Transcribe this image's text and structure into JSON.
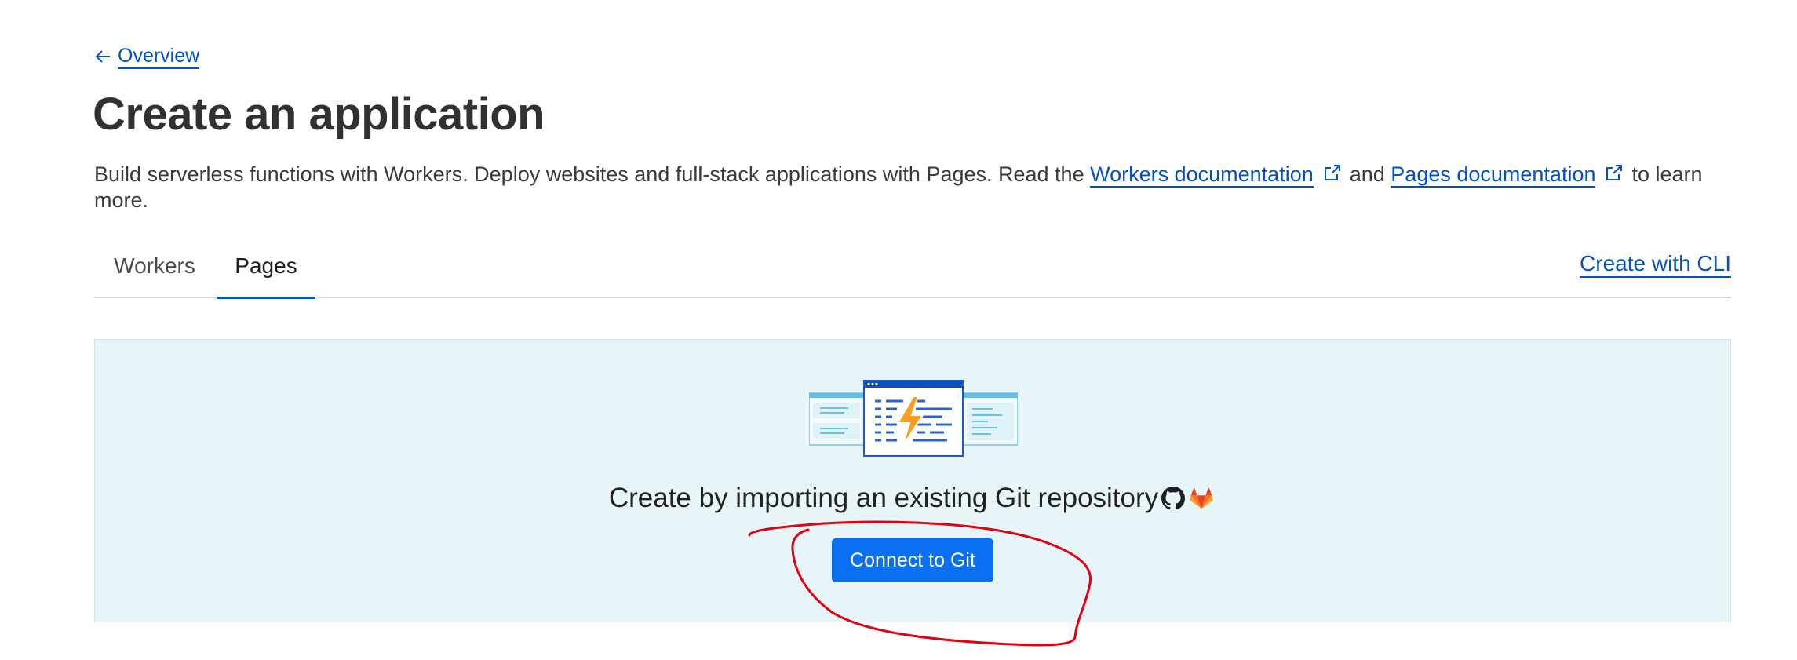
{
  "nav": {
    "back_label": "Overview"
  },
  "header": {
    "title": "Create an application",
    "description_prefix": "Build serverless functions with Workers. Deploy websites and full-stack applications with Pages. Read the ",
    "workers_docs_link": "Workers documentation",
    "and_text": "and ",
    "pages_docs_link": "Pages documentation",
    "description_suffix": "to learn more."
  },
  "tabs": [
    {
      "label": "Workers",
      "active": false
    },
    {
      "label": "Pages",
      "active": true
    }
  ],
  "cli_link": "Create with CLI",
  "panel": {
    "heading": "Create by importing an existing Git repository",
    "button_label": "Connect to Git",
    "provider_icons": [
      "github-icon",
      "gitlab-icon"
    ]
  },
  "colors": {
    "link": "#0051c3",
    "button": "#0a6ff0",
    "panel_bg": "#e8f5f8",
    "annotation": "#e0000f"
  }
}
